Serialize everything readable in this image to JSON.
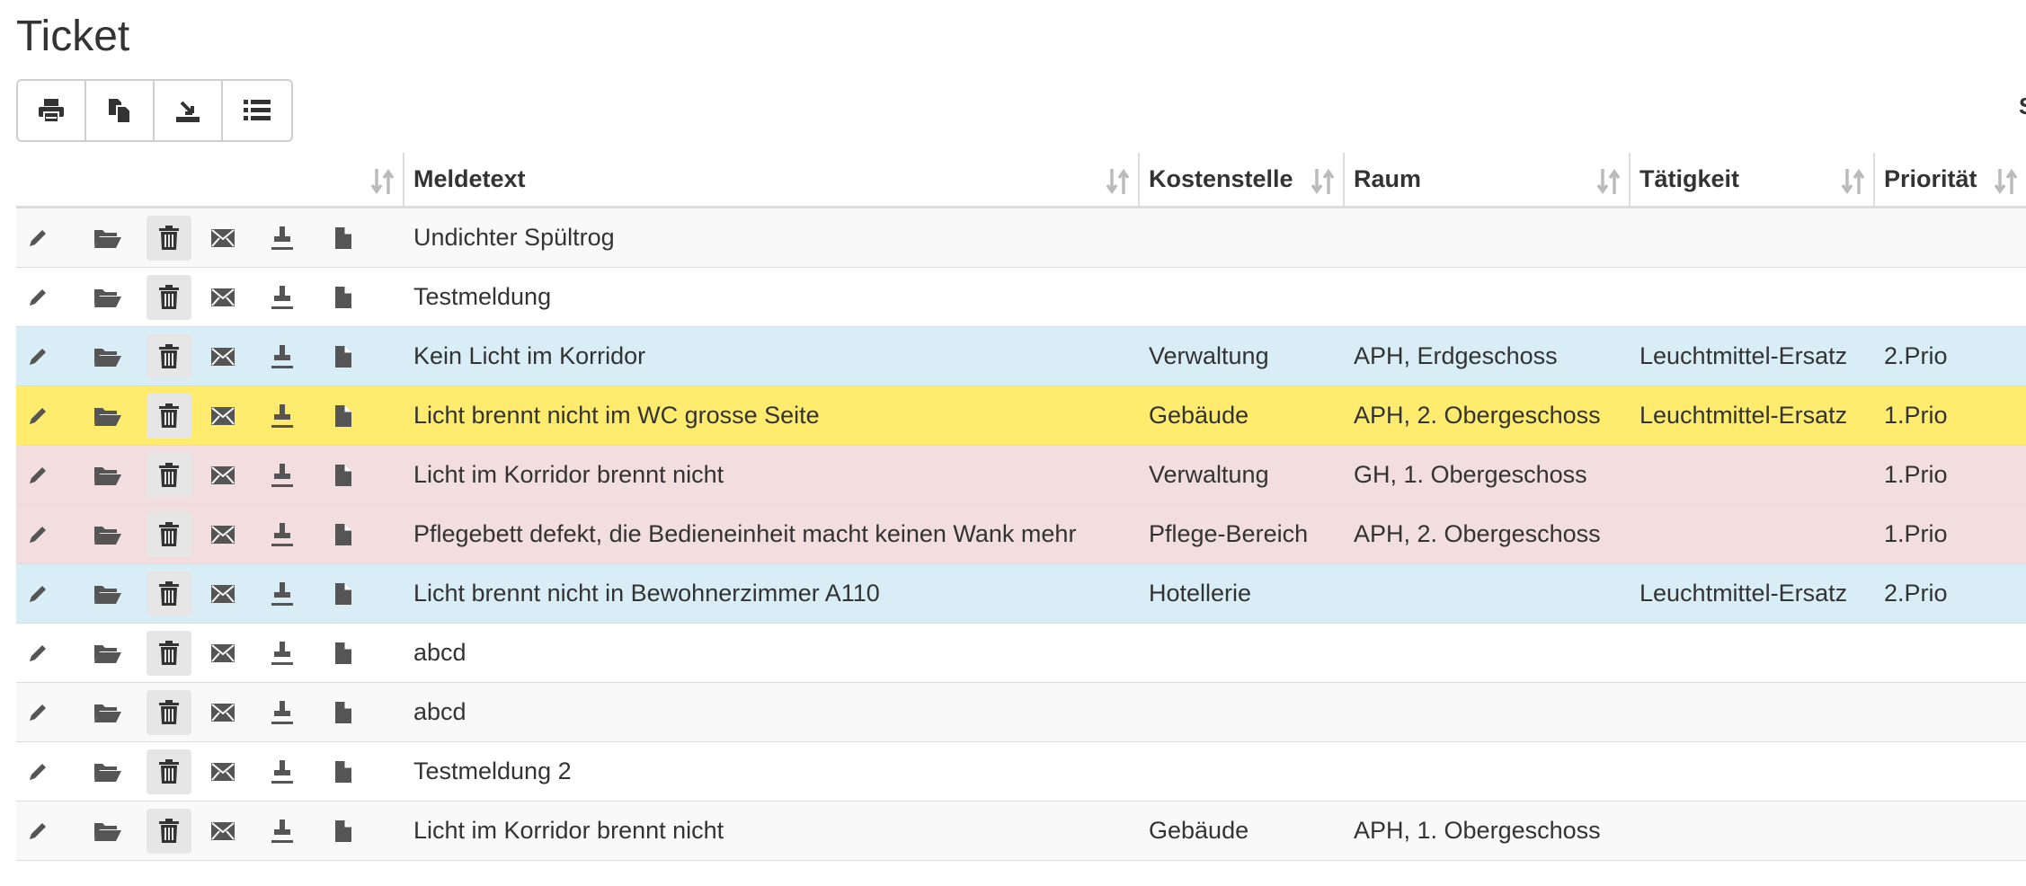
{
  "page": {
    "title": "Ticket"
  },
  "toolbar": {
    "buttons": [
      {
        "icon": "print-icon"
      },
      {
        "icon": "copy-icon"
      },
      {
        "icon": "export-icon"
      },
      {
        "icon": "list-icon"
      }
    ],
    "edge_text": "S"
  },
  "table": {
    "columns": [
      "",
      "Meldetext",
      "Kostenstelle",
      "Raum",
      "Tätigkeit",
      "Priorität"
    ],
    "row_actions": [
      "edit-icon",
      "open-folder-icon",
      "trash-icon",
      "email-icon",
      "stamp-icon",
      "document-icon"
    ],
    "rows": [
      {
        "style": "odd",
        "meldetext": "Undichter Spültrog",
        "kostenstelle": "",
        "raum": "",
        "taetigkeit": "",
        "prioritaet": ""
      },
      {
        "style": "even",
        "meldetext": "Testmeldung",
        "kostenstelle": "",
        "raum": "",
        "taetigkeit": "",
        "prioritaet": ""
      },
      {
        "style": "info",
        "meldetext": "Kein Licht im Korridor",
        "kostenstelle": "Verwaltung",
        "raum": "APH, Erdgeschoss",
        "taetigkeit": "Leuchtmittel-Ersatz",
        "prioritaet": "2.Prio"
      },
      {
        "style": "warning",
        "meldetext": "Licht brennt nicht im WC grosse Seite",
        "kostenstelle": "Gebäude",
        "raum": "APH, 2. Obergeschoss",
        "taetigkeit": "Leuchtmittel-Ersatz",
        "prioritaet": "1.Prio"
      },
      {
        "style": "danger",
        "meldetext": "Licht im Korridor brennt nicht",
        "kostenstelle": "Verwaltung",
        "raum": "GH, 1. Obergeschoss",
        "taetigkeit": "",
        "prioritaet": "1.Prio"
      },
      {
        "style": "danger",
        "meldetext": "Pflegebett defekt, die Bedieneinheit macht keinen Wank mehr",
        "kostenstelle": "Pflege-Bereich",
        "raum": "APH, 2. Obergeschoss",
        "taetigkeit": "",
        "prioritaet": "1.Prio"
      },
      {
        "style": "info",
        "meldetext": "Licht brennt nicht in Bewohnerzimmer A110",
        "kostenstelle": "Hotellerie",
        "raum": "",
        "taetigkeit": "Leuchtmittel-Ersatz",
        "prioritaet": "2.Prio"
      },
      {
        "style": "even",
        "meldetext": "abcd",
        "kostenstelle": "",
        "raum": "",
        "taetigkeit": "",
        "prioritaet": ""
      },
      {
        "style": "odd",
        "meldetext": "abcd",
        "kostenstelle": "",
        "raum": "",
        "taetigkeit": "",
        "prioritaet": ""
      },
      {
        "style": "even",
        "meldetext": "Testmeldung 2",
        "kostenstelle": "",
        "raum": "",
        "taetigkeit": "",
        "prioritaet": ""
      },
      {
        "style": "odd",
        "meldetext": "Licht im Korridor brennt nicht",
        "kostenstelle": "Gebäude",
        "raum": "APH, 1. Obergeschoss",
        "taetigkeit": "",
        "prioritaet": ""
      }
    ]
  },
  "colors": {
    "info": "#d9edf7",
    "warning": "#ffec6e",
    "danger": "#f2dede",
    "odd": "#f9f9f9",
    "even": "#ffffff",
    "icon": "#555555",
    "sort_icon": "#bbbbbb"
  }
}
